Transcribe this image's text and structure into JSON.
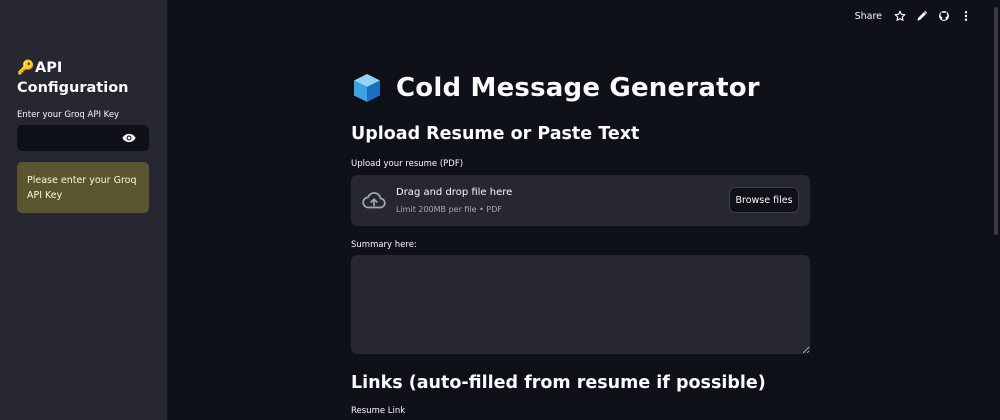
{
  "sidebar": {
    "title": "API Configuration",
    "title_icon": "key-icon",
    "api_key_label": "Enter your Groq API Key",
    "api_key_value": "",
    "warning": "Please enter your Groq API Key"
  },
  "toolbar": {
    "share_label": "Share",
    "icons": [
      "star-icon",
      "edit-icon",
      "github-icon",
      "more-vertical-icon"
    ]
  },
  "main": {
    "title": "Cold Message Generator",
    "title_icon": "cube-icon",
    "upload_section_title": "Upload Resume or Paste Text",
    "upload_label": "Upload your resume (PDF)",
    "dropzone_text": "Drag and drop file here",
    "dropzone_limit": "Limit 200MB per file • PDF",
    "browse_button": "Browse files",
    "summary_label": "Summary here:",
    "summary_value": "",
    "links_section_title": "Links (auto-filled from resume if possible)",
    "resume_link_label": "Resume Link"
  },
  "colors": {
    "background": "#0e1117",
    "sidebar": "#262730",
    "input_bg": "#262730",
    "warning_bg": "#5a5530",
    "warning_text": "#fffbc8",
    "text": "#fafafa"
  }
}
